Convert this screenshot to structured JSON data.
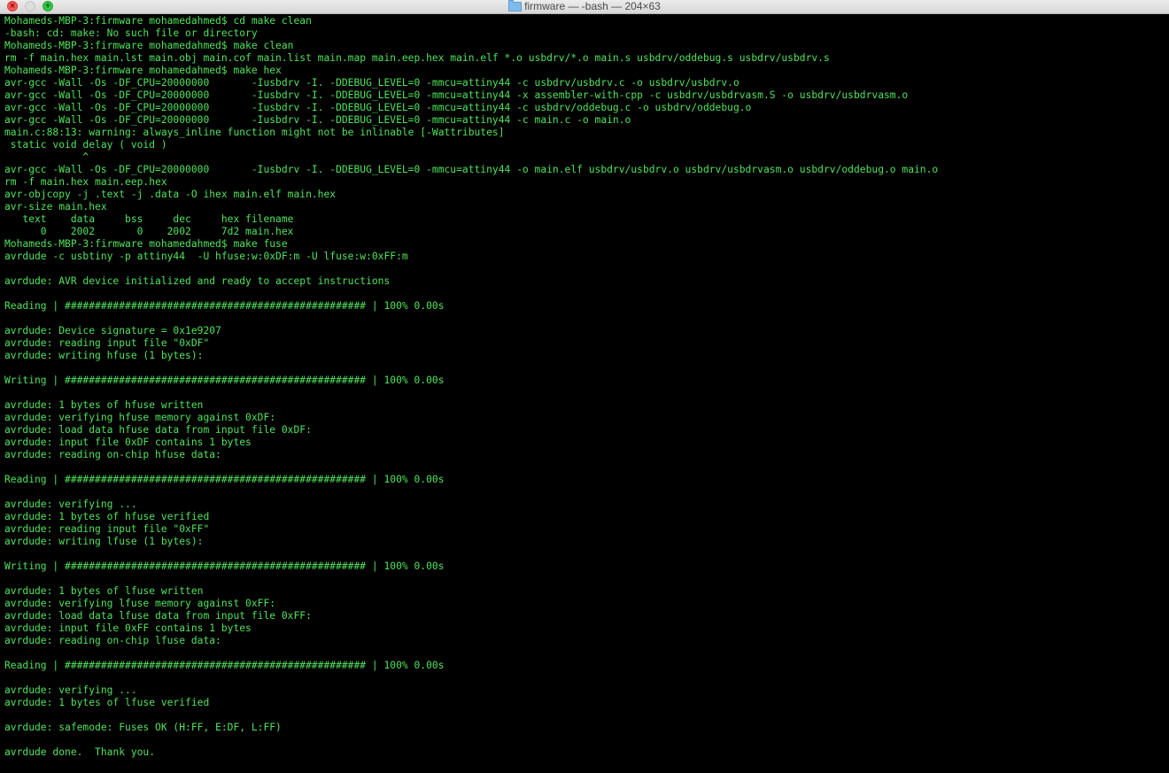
{
  "window": {
    "title": "firmware — -bash — 204×63",
    "folder_icon": "folder-icon",
    "buttons": {
      "close_icon": "close-icon",
      "minimize_icon": "minimize-icon",
      "zoom_icon": "zoom-icon"
    },
    "text_color": "#4fe35a",
    "background_color": "#000000"
  },
  "terminal": {
    "lines": [
      "Mohameds-MBP-3:firmware mohamedahmed$ cd make clean",
      "-bash: cd: make: No such file or directory",
      "Mohameds-MBP-3:firmware mohamedahmed$ make clean",
      "rm -f main.hex main.lst main.obj main.cof main.list main.map main.eep.hex main.elf *.o usbdrv/*.o main.s usbdrv/oddebug.s usbdrv/usbdrv.s",
      "Mohameds-MBP-3:firmware mohamedahmed$ make hex",
      "avr-gcc -Wall -Os -DF_CPU=20000000       -Iusbdrv -I. -DDEBUG_LEVEL=0 -mmcu=attiny44 -c usbdrv/usbdrv.c -o usbdrv/usbdrv.o",
      "avr-gcc -Wall -Os -DF_CPU=20000000       -Iusbdrv -I. -DDEBUG_LEVEL=0 -mmcu=attiny44 -x assembler-with-cpp -c usbdrv/usbdrvasm.S -o usbdrv/usbdrvasm.o",
      "avr-gcc -Wall -Os -DF_CPU=20000000       -Iusbdrv -I. -DDEBUG_LEVEL=0 -mmcu=attiny44 -c usbdrv/oddebug.c -o usbdrv/oddebug.o",
      "avr-gcc -Wall -Os -DF_CPU=20000000       -Iusbdrv -I. -DDEBUG_LEVEL=0 -mmcu=attiny44 -c main.c -o main.o",
      "main.c:88:13: warning: always_inline function might not be inlinable [-Wattributes]",
      " static void delay ( void )",
      "             ^",
      "avr-gcc -Wall -Os -DF_CPU=20000000       -Iusbdrv -I. -DDEBUG_LEVEL=0 -mmcu=attiny44 -o main.elf usbdrv/usbdrv.o usbdrv/usbdrvasm.o usbdrv/oddebug.o main.o",
      "rm -f main.hex main.eep.hex",
      "avr-objcopy -j .text -j .data -O ihex main.elf main.hex",
      "avr-size main.hex",
      "   text    data     bss     dec     hex filename",
      "      0    2002       0    2002     7d2 main.hex",
      "Mohameds-MBP-3:firmware mohamedahmed$ make fuse",
      "avrdude -c usbtiny -p attiny44  -U hfuse:w:0xDF:m -U lfuse:w:0xFF:m",
      "",
      "avrdude: AVR device initialized and ready to accept instructions",
      "",
      "Reading | ################################################## | 100% 0.00s",
      "",
      "avrdude: Device signature = 0x1e9207",
      "avrdude: reading input file \"0xDF\"",
      "avrdude: writing hfuse (1 bytes):",
      "",
      "Writing | ################################################## | 100% 0.00s",
      "",
      "avrdude: 1 bytes of hfuse written",
      "avrdude: verifying hfuse memory against 0xDF:",
      "avrdude: load data hfuse data from input file 0xDF:",
      "avrdude: input file 0xDF contains 1 bytes",
      "avrdude: reading on-chip hfuse data:",
      "",
      "Reading | ################################################## | 100% 0.00s",
      "",
      "avrdude: verifying ...",
      "avrdude: 1 bytes of hfuse verified",
      "avrdude: reading input file \"0xFF\"",
      "avrdude: writing lfuse (1 bytes):",
      "",
      "Writing | ################################################## | 100% 0.00s",
      "",
      "avrdude: 1 bytes of lfuse written",
      "avrdude: verifying lfuse memory against 0xFF:",
      "avrdude: load data lfuse data from input file 0xFF:",
      "avrdude: input file 0xFF contains 1 bytes",
      "avrdude: reading on-chip lfuse data:",
      "",
      "Reading | ################################################## | 100% 0.00s",
      "",
      "avrdude: verifying ...",
      "avrdude: 1 bytes of lfuse verified",
      "",
      "avrdude: safemode: Fuses OK (H:FF, E:DF, L:FF)",
      "",
      "avrdude done.  Thank you.",
      ""
    ]
  }
}
